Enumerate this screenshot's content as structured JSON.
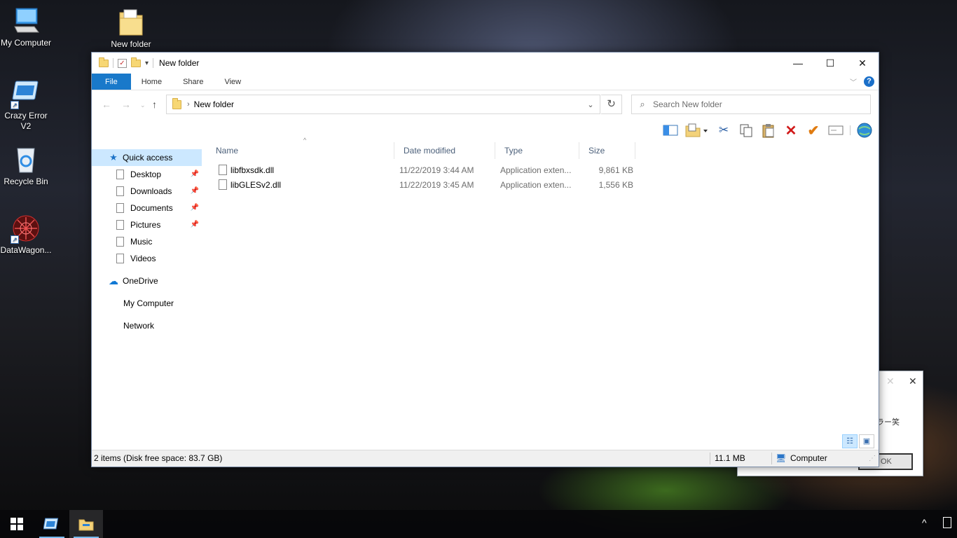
{
  "desktop": {
    "icons": [
      {
        "label": "My Computer",
        "icon": "computer-icon"
      },
      {
        "label": "New folder",
        "icon": "folder-icon"
      },
      {
        "label": "Crazy Error V2",
        "icon": "app-window-icon"
      },
      {
        "label": "Recycle Bin",
        "icon": "recycle-bin-icon"
      },
      {
        "label": "DataWagon...",
        "icon": "datawagon-icon"
      }
    ]
  },
  "window": {
    "title": "New folder",
    "controls": {
      "minimize": "—",
      "maximize": "☐",
      "close": "✕"
    },
    "ribbon_tabs": [
      "File",
      "Home",
      "Share",
      "View"
    ],
    "help": "?",
    "address": {
      "path": "New folder"
    },
    "search": {
      "placeholder": "Search New folder"
    },
    "toolbar_icons": [
      "preview-pane-icon",
      "new-folder-icon",
      "cut-icon",
      "copy-icon",
      "paste-icon",
      "delete-icon",
      "checkmark-icon",
      "rename-icon",
      "globe-icon"
    ],
    "nav": {
      "quick_access": "Quick access",
      "pinned": [
        {
          "label": "Desktop",
          "pinned": true
        },
        {
          "label": "Downloads",
          "pinned": true
        },
        {
          "label": "Documents",
          "pinned": true
        },
        {
          "label": "Pictures",
          "pinned": true
        },
        {
          "label": "Music",
          "pinned": false
        },
        {
          "label": "Videos",
          "pinned": false
        }
      ],
      "onedrive": "OneDrive",
      "my_computer": "My Computer",
      "network": "Network"
    },
    "columns": {
      "name": "Name",
      "date": "Date modified",
      "type": "Type",
      "size": "Size"
    },
    "files": [
      {
        "name": "libfbxsdk.dll",
        "date": "11/22/2019 3:44 AM",
        "type": "Application exten...",
        "size": "9,861 KB"
      },
      {
        "name": "libGLESv2.dll",
        "date": "11/22/2019 3:45 AM",
        "type": "Application exten...",
        "size": "1,556 KB"
      }
    ],
    "status": {
      "items": "2 items (Disk free space: 83.7 GB)",
      "total_size": "11.1 MB",
      "location": "Computer"
    }
  },
  "dialog": {
    "close": "✕",
    "message_fragment": "ラー笑",
    "ok_label": "OK"
  },
  "taskbar": {
    "items": [
      "start-icon",
      "crazy-error-icon",
      "file-explorer-icon"
    ],
    "tray": "^"
  }
}
